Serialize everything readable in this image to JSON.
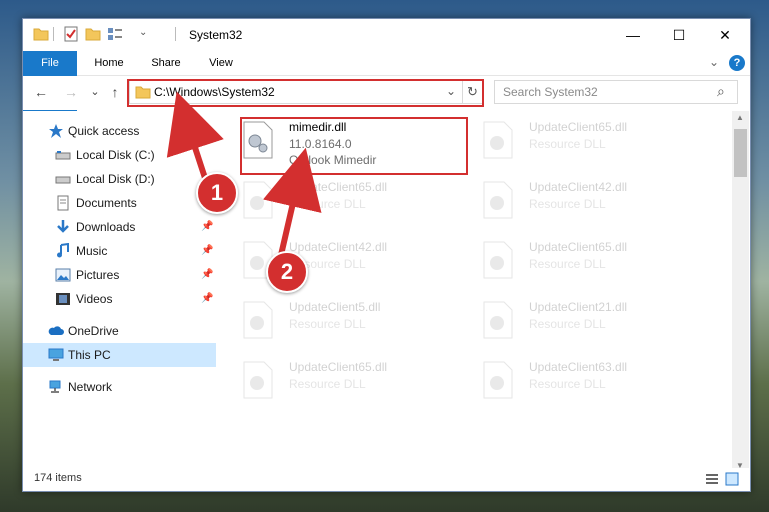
{
  "window": {
    "title": "System32",
    "controls": {
      "minimize": "—",
      "maximize": "☐",
      "close": "✕"
    }
  },
  "ribbon": {
    "tabs": [
      "File",
      "Home",
      "Share",
      "View"
    ],
    "collapse": "⌄",
    "help": "?"
  },
  "nav": {
    "back": "←",
    "forward": "→",
    "recent": "⌄",
    "up": "↑",
    "address": "C:\\Windows\\System32",
    "address_dropdown": "⌄",
    "refresh": "↻",
    "search_placeholder": "Search System32",
    "search_icon": "⌕"
  },
  "sidebar": {
    "items": [
      {
        "label": "Quick access",
        "icon": "star-icon"
      },
      {
        "label": "Local Disk (C:)",
        "icon": "drive-icon"
      },
      {
        "label": "Local Disk (D:)",
        "icon": "drive-icon"
      },
      {
        "label": "Documents",
        "icon": "documents-icon"
      },
      {
        "label": "Downloads",
        "icon": "download-icon",
        "pinned": true
      },
      {
        "label": "Music",
        "icon": "music-icon",
        "pinned": true
      },
      {
        "label": "Pictures",
        "icon": "pictures-icon",
        "pinned": true
      },
      {
        "label": "Videos",
        "icon": "videos-icon",
        "pinned": true
      },
      {
        "label": "OneDrive",
        "icon": "cloud-icon"
      },
      {
        "label": "This PC",
        "icon": "computer-icon",
        "selected": true
      },
      {
        "label": "Network",
        "icon": "network-icon"
      }
    ],
    "pin_glyph": "📌"
  },
  "files": {
    "highlighted": {
      "name": "mimedir.dll",
      "version": "11.0.8164.0",
      "description": "Outlook Mimedir"
    },
    "faded": [
      {
        "name": "UpdateClient65.dll",
        "type": "Resource DLL"
      },
      {
        "name": "UpdateClient65.dll",
        "type": "Resource DLL"
      },
      {
        "name": "UpdateClient42.dll",
        "type": "Resource DLL"
      },
      {
        "name": "UpdateClient42.dll",
        "type": "Resource DLL"
      },
      {
        "name": "UpdateClient65.dll",
        "type": "Resource DLL"
      },
      {
        "name": "UpdateClient5.dll",
        "type": "Resource DLL"
      },
      {
        "name": "UpdateClient21.dll",
        "type": "Resource DLL"
      },
      {
        "name": "UpdateClient65.dll",
        "type": "Resource DLL"
      },
      {
        "name": "UpdateClient63.dll",
        "type": "Resource DLL"
      }
    ]
  },
  "status": {
    "items_count": "174 items"
  },
  "callouts": [
    "1",
    "2"
  ],
  "colors": {
    "accent": "#1979ca",
    "highlight": "#d32f2f",
    "selection": "#cde8ff"
  }
}
